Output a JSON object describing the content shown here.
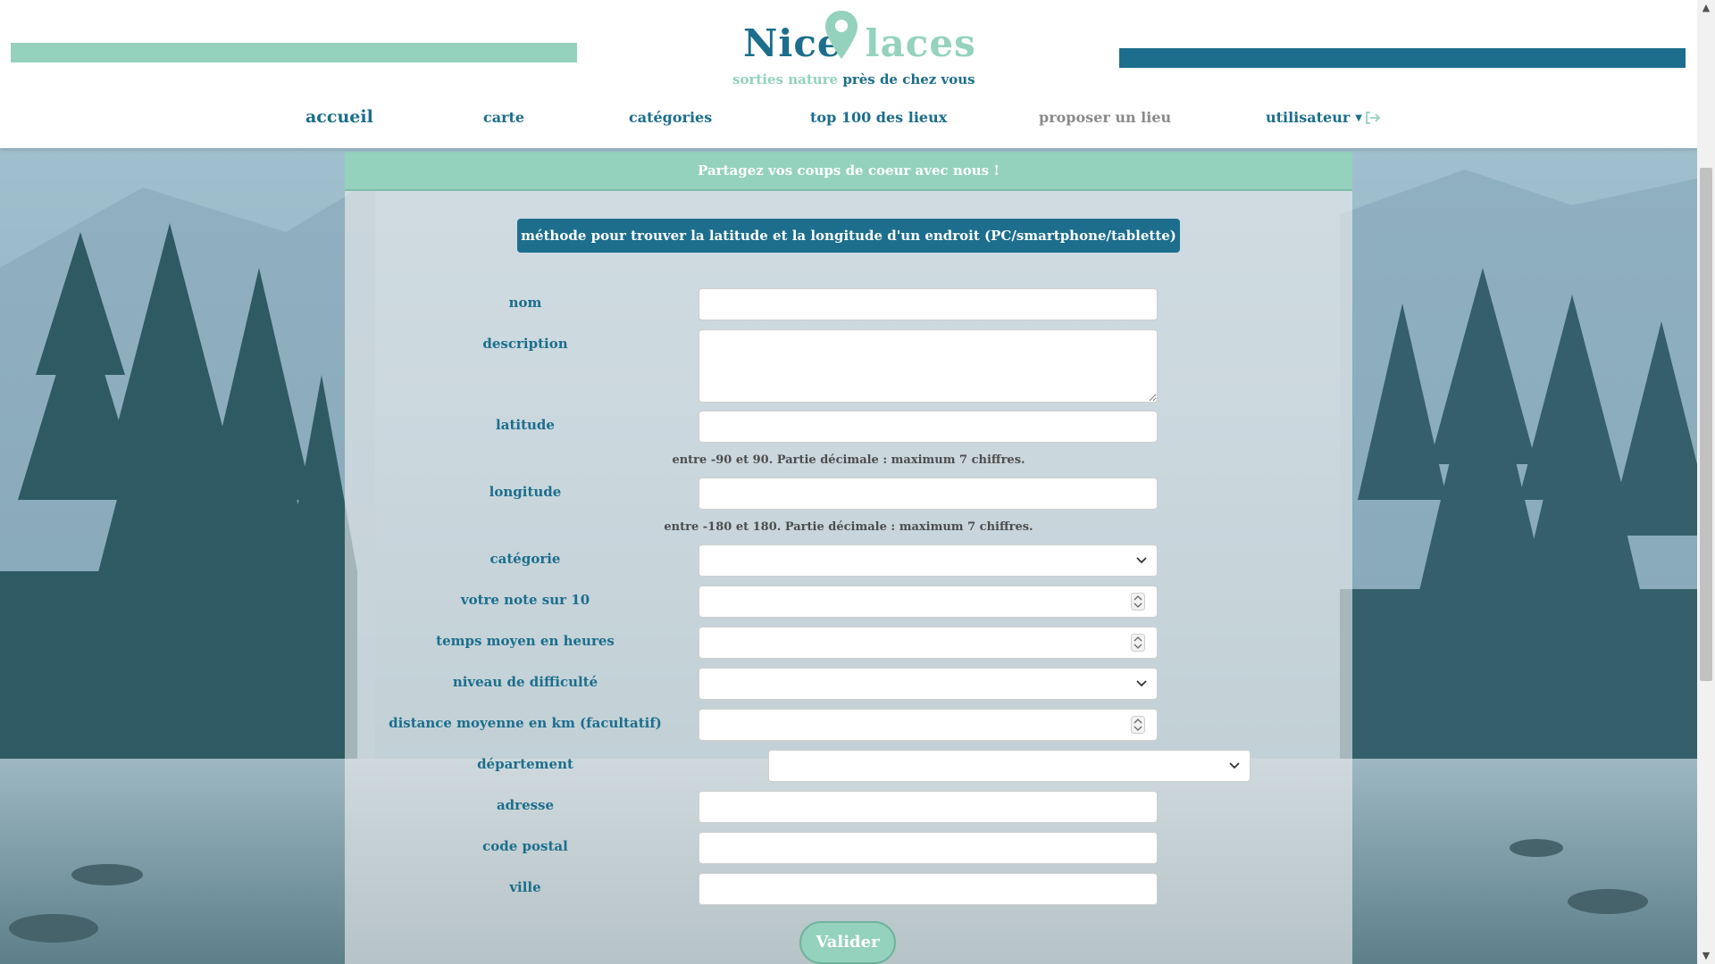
{
  "header": {
    "logo": {
      "part1": "Nice",
      "part2": "laces"
    },
    "tagline": {
      "part1": "sorties nature",
      "part2": "près de chez vous"
    },
    "colors": {
      "primary": "#1c6e8c",
      "accent": "#94d2bd"
    }
  },
  "nav": {
    "home": "accueil",
    "map": "carte",
    "categories": "catégories",
    "top": "top 100 des lieux",
    "propose": "proposer un lieu",
    "user": "utilisateur",
    "logout_icon": "sign-out-icon"
  },
  "panel": {
    "title": "Partagez vos coups de coeur avec nous !",
    "method_button": "méthode pour trouver la latitude et la longitude d'un endroit (PC/smartphone/tablette)"
  },
  "form": {
    "name_label": "nom",
    "description_label": "description",
    "latitude_label": "latitude",
    "latitude_hint": "entre -90 et 90. Partie décimale : maximum 7 chiffres.",
    "longitude_label": "longitude",
    "longitude_hint": "entre -180 et 180. Partie décimale : maximum 7 chiffres.",
    "category_label": "catégorie",
    "rating_label": "votre note sur 10",
    "time_label": "temps moyen en heures",
    "difficulty_label": "niveau de difficulté",
    "distance_label": "distance moyenne en km (facultatif)",
    "department_label": "département",
    "address_label": "adresse",
    "postal_label": "code postal",
    "city_label": "ville",
    "submit_label": "Valider"
  }
}
